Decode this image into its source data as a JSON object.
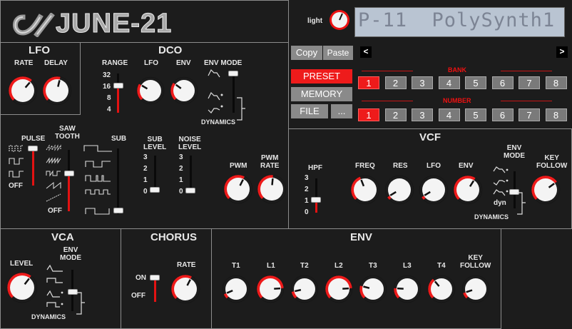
{
  "logo": {
    "text": "JUNE-21"
  },
  "header": {
    "light_label": "light",
    "display_text": "P-11  PolySynth1"
  },
  "patch": {
    "copy_label": "Copy",
    "paste_label": "Paste",
    "prev_label": "<",
    "next_label": ">",
    "preset_label": "PRESET",
    "memory_label": "MEMORY",
    "file_label": "FILE",
    "more_label": "...",
    "bank_label": "BANK",
    "number_label": "NUMBER",
    "banks": [
      "1",
      "2",
      "3",
      "4",
      "5",
      "6",
      "7",
      "8"
    ],
    "numbers": [
      "1",
      "2",
      "3",
      "4",
      "5",
      "6",
      "7",
      "8"
    ],
    "selected_bank": "1",
    "selected_number": "1"
  },
  "lfo": {
    "title": "LFO",
    "rate_label": "RATE",
    "delay_label": "DELAY"
  },
  "dco": {
    "title": "DCO",
    "range_label": "RANGE",
    "range_values": [
      "32",
      "16",
      "8",
      "4"
    ],
    "lfo_label": "LFO",
    "env_label": "ENV",
    "env_mode_label": "ENV MODE",
    "dynamics_label": "DYNAMICS",
    "pulse_label": "PULSE",
    "saw_label": "SAW\nTOOTH",
    "sub_label": "SUB",
    "off_label": "OFF",
    "sub_level_label": "SUB\nLEVEL",
    "noise_level_label": "NOISE\nLEVEL",
    "level_values": [
      "3",
      "2",
      "1",
      "0"
    ],
    "pwm_label": "PWM",
    "pwm_rate_label": "PWM\nRATE"
  },
  "vcf": {
    "title": "VCF",
    "hpf_label": "HPF",
    "hpf_values": [
      "3",
      "2",
      "1",
      "0"
    ],
    "freq_label": "FREQ",
    "res_label": "RES",
    "lfo_label": "LFO",
    "env_label": "ENV",
    "env_mode_label": "ENV\nMODE",
    "dyn_label": "dyn",
    "dynamics_label": "DYNAMICS",
    "key_follow_label": "KEY\nFOLLOW"
  },
  "vca": {
    "title": "VCA",
    "level_label": "LEVEL",
    "env_mode_label": "ENV\nMODE",
    "dynamics_label": "DYNAMICS"
  },
  "chorus": {
    "title": "CHORUS",
    "on_label": "ON",
    "off_label": "OFF",
    "rate_label": "RATE"
  },
  "env": {
    "title": "ENV",
    "t1_label": "T1",
    "l1_label": "L1",
    "t2_label": "T2",
    "l2_label": "L2",
    "t3_label": "T3",
    "l3_label": "L3",
    "t4_label": "T4",
    "key_follow_label": "KEY\nFOLLOW"
  },
  "colors": {
    "accent": "#ee1b1b",
    "panel_border": "#8c8c8c",
    "background": "#1c1c1c",
    "display": "#b9c4d2"
  }
}
